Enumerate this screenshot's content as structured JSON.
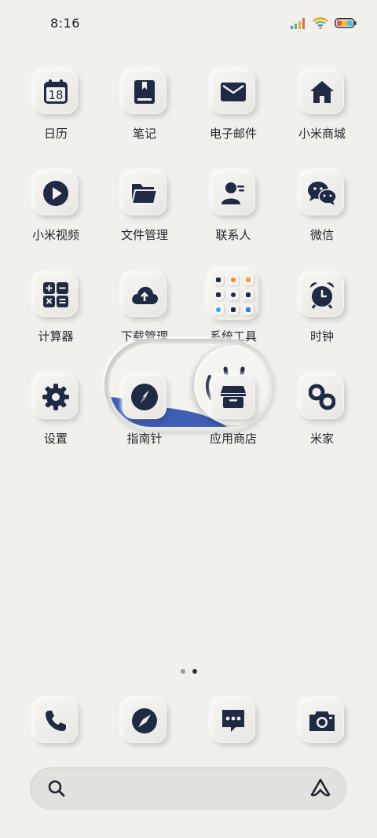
{
  "status_bar": {
    "time": "8:16"
  },
  "apps": [
    {
      "label": "日历",
      "icon": "calendar-icon",
      "day": "18"
    },
    {
      "label": "笔记",
      "icon": "notes-icon"
    },
    {
      "label": "电子邮件",
      "icon": "mail-icon"
    },
    {
      "label": "小米商城",
      "icon": "store-home-icon"
    },
    {
      "label": "小米视频",
      "icon": "play-icon"
    },
    {
      "label": "文件管理",
      "icon": "folder-icon"
    },
    {
      "label": "联系人",
      "icon": "contacts-icon"
    },
    {
      "label": "微信",
      "icon": "wechat-icon"
    },
    {
      "label": "计算器",
      "icon": "calculator-icon"
    },
    {
      "label": "下载管理",
      "icon": "cloud-upload-icon"
    },
    {
      "label": "系统工具",
      "icon": "folder-grid-icon"
    },
    {
      "label": "时钟",
      "icon": "alarm-clock-icon"
    },
    {
      "label": "设置",
      "icon": "gear-icon"
    },
    {
      "label": "指南针",
      "icon": "compass-icon"
    },
    {
      "label": "应用商店",
      "icon": "app-store-icon"
    },
    {
      "label": "米家",
      "icon": "link-icon"
    }
  ],
  "page_indicator": {
    "count": 2,
    "active": 2
  },
  "dock": [
    {
      "icon": "phone-icon"
    },
    {
      "icon": "browser-compass-icon"
    },
    {
      "icon": "message-icon"
    },
    {
      "icon": "camera-icon"
    }
  ],
  "search": {
    "placeholder": ""
  },
  "colors": {
    "background": "#f1f0ed",
    "icon": "#1f2a44",
    "accent_blue": "#3f5fb5"
  }
}
